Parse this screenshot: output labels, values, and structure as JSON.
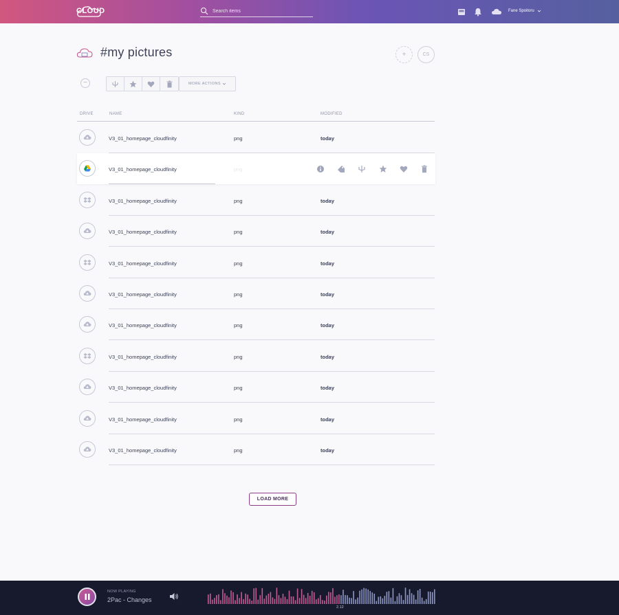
{
  "header": {
    "logo_text": "CLOUD",
    "search_placeholder": "Search items",
    "user_name": "Fane Spoitoru"
  },
  "page": {
    "title": "#my pictures",
    "cs_label": "CS",
    "add_label": "+"
  },
  "toolbar": {
    "minus_label": "−",
    "more_actions_label": "MORE ACTIONS"
  },
  "table": {
    "columns": {
      "drive": "DRIVE",
      "name": "NAME",
      "kind": "KIND",
      "modified": "MODIFIED"
    },
    "rows": [
      {
        "drive": "cloudfinity",
        "name": "V3_01_homepage_cloudfinity",
        "kind": "png",
        "modified": "today"
      },
      {
        "drive": "google-drive",
        "name": "V3_01_homepage_cloudfinity",
        "kind": "png",
        "modified": ""
      },
      {
        "drive": "dropbox",
        "name": "V3_01_homepage_cloudfinity",
        "kind": "png",
        "modified": "today"
      },
      {
        "drive": "cloudfinity",
        "name": "V3_01_homepage_cloudfinity",
        "kind": "png",
        "modified": "today"
      },
      {
        "drive": "dropbox",
        "name": "V3_01_homepage_cloudfinity",
        "kind": "png",
        "modified": "today"
      },
      {
        "drive": "cloudfinity",
        "name": "V3_01_homepage_cloudfinity",
        "kind": "png",
        "modified": "today"
      },
      {
        "drive": "cloudfinity",
        "name": "V3_01_homepage_cloudfinity",
        "kind": "png",
        "modified": "today"
      },
      {
        "drive": "dropbox",
        "name": "V3_01_homepage_cloudfinity",
        "kind": "png",
        "modified": "today"
      },
      {
        "drive": "cloudfinity",
        "name": "V3_01_homepage_cloudfinity",
        "kind": "png",
        "modified": "today"
      },
      {
        "drive": "cloudfinity",
        "name": "V3_01_homepage_cloudfinity",
        "kind": "png",
        "modified": "today"
      },
      {
        "drive": "cloudfinity",
        "name": "V3_01_homepage_cloudfinity",
        "kind": "png",
        "modified": "today"
      }
    ],
    "active_row_actions": [
      "info-icon",
      "tag-icon",
      "share-icon",
      "star-icon",
      "heart-icon",
      "trash-icon"
    ]
  },
  "load_more_label": "LOAD MORE",
  "player": {
    "now_playing_label": "NOW PLAYING",
    "track": "2Pac - Changes",
    "time": "2.12",
    "progress": 0.58
  },
  "colors": {
    "accent_pink": "#d1577f",
    "accent_purple": "#6a55b5",
    "player_bg": "#161a2c",
    "wave_played": "#c35b93",
    "wave_unplayed": "#8e97c4"
  }
}
